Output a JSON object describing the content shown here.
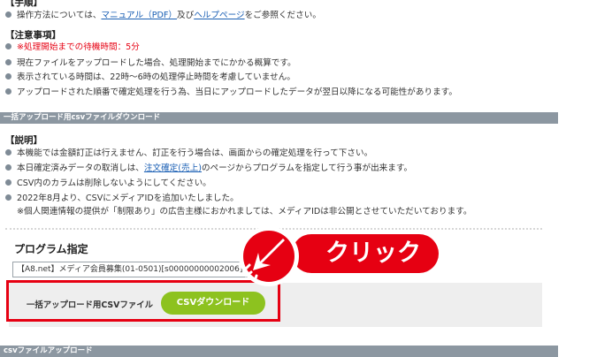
{
  "top_section": {
    "heading": "【手順】",
    "manual_prefix": "操作方法については、",
    "manual_link": "マニュアル（PDF）",
    "manual_mid": "及び",
    "help_link": "ヘルプページ",
    "manual_suffix": "をご参照ください。"
  },
  "notes": {
    "heading": "【注意事項】",
    "wait_time": "※処理開始までの待機時間：5分",
    "items": [
      "現在ファイルをアップロードした場合、処理開始までにかかる概算です。",
      "表示されている時間は、22時～6時の処理停止時間を考慮していません。",
      "アップロードされた順番で確定処理を行う為、当日にアップロードしたデータが翌日以降になる可能性があります。"
    ]
  },
  "download_section": {
    "bar_title": "一括アップロード用csvファイルダウンロード",
    "heading": "【説明】",
    "item1": "本機能では金額訂正は行えません、訂正を行う場合は、画面からの確定処理を行って下さい。",
    "item2_prefix": "本日確定済みデータの取消しは、",
    "item2_link": "注文確定(売上)",
    "item2_suffix": "のページからプログラムを指定して行う事が出来ます。",
    "item3": "CSV内のカラムは削除しないようにしてください。",
    "item4": "2022年8月より、CSVにメディアIDを追加いたしました。",
    "item4_note": "※個人関連情報の提供が「制限あり」の広告主様におかれましては、メディアIDは非公開とさせていただいております。"
  },
  "program": {
    "label": "プログラム指定",
    "selected_value": "【A8.net】メディア会員募集(01-0501)[s00000000002006](27"
  },
  "csv_download": {
    "label": "一括アップロード用CSVファイル",
    "button_label": "CSVダウンロード"
  },
  "callout": {
    "text": "クリック"
  },
  "upload_section": {
    "bar_title": "csvファイルアップロード"
  },
  "colors": {
    "accent_red": "#e60012",
    "button_green": "#8dc21f",
    "section_bar": "#8c97a1"
  }
}
